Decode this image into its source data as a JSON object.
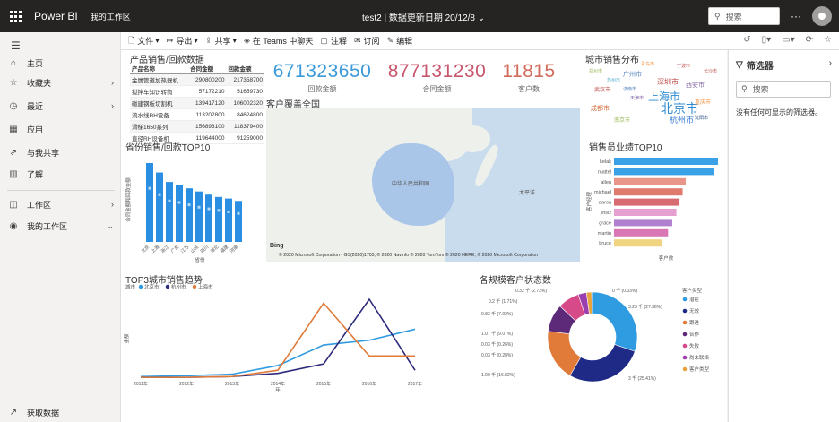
{
  "topbar": {
    "app_name": "Power BI",
    "workspace": "我的工作区",
    "report_title": "test2 | 数据更新日期 20/12/8",
    "search_placeholder": "搜索",
    "more": "···"
  },
  "toolbar": {
    "items": [
      {
        "label": "文件",
        "icon": "file-icon",
        "caret": "▾"
      },
      {
        "label": "导出",
        "icon": "export-icon",
        "caret": "▾"
      },
      {
        "label": "共享",
        "icon": "share-icon",
        "caret": "▾"
      },
      {
        "label": "在 Teams 中聊天",
        "icon": "teams-icon",
        "caret": ""
      },
      {
        "label": "注释",
        "icon": "comment-icon",
        "caret": ""
      },
      {
        "label": "订阅",
        "icon": "mail-icon",
        "caret": ""
      },
      {
        "label": "编辑",
        "icon": "edit-icon",
        "caret": ""
      }
    ]
  },
  "sidebar": {
    "items": [
      {
        "label": "主页",
        "icon": "home-icon"
      },
      {
        "label": "收藏夹",
        "icon": "star-icon",
        "chevron": "›"
      },
      {
        "label": "最近",
        "icon": "clock-icon",
        "chevron": "›"
      },
      {
        "label": "应用",
        "icon": "apps-icon"
      },
      {
        "label": "与我共享",
        "icon": "shared-icon"
      },
      {
        "label": "了解",
        "icon": "book-icon"
      },
      {
        "label": "工作区",
        "icon": "workspace-icon",
        "chevron": "›"
      },
      {
        "label": "我的工作区",
        "icon": "my-workspace-icon",
        "chevron": "⌄"
      }
    ],
    "get_data": "获取数据"
  },
  "filters": {
    "title": "筛选器",
    "search_placeholder": "搜索",
    "empty_text": "没有任何可显示的筛选器。"
  },
  "visuals": {
    "table": {
      "title": "产品销售/回款数据",
      "headers": [
        "产品名称",
        "合同金额",
        "回款金额"
      ],
      "rows": [
        [
          "金属管道加热器机",
          "290800200",
          "217358700"
        ],
        [
          "搅拌车知识转筒",
          "57172210",
          "51659730"
        ],
        [
          "磁建钢板切割机",
          "139417120",
          "106002320"
        ],
        [
          "流水线RH设备",
          "113202800",
          "84624800"
        ],
        [
          "滑梯1650系列",
          "156893100",
          "118379400"
        ],
        [
          "直径RH设备机",
          "119644000",
          "91259000"
        ]
      ]
    },
    "kpis": [
      {
        "value": "671323650",
        "label": "回款金额",
        "color": "#3a9ad9"
      },
      {
        "value": "877131230",
        "label": "合同金额",
        "color": "#c8566e"
      },
      {
        "value": "11815",
        "label": "客户数",
        "color": "#d16b5b"
      }
    ],
    "map": {
      "title": "客户覆盖全国",
      "label_china": "中华人民共和国",
      "label_ocean": "太平洋",
      "bing": "Bing",
      "attribution": "© 2020 Microsoft Corporation - GS(2020)1703, © 2020 Navinfo © 2020 TomTom © 2020 HERE, © 2020 Microsoft Corporation"
    },
    "wordcloud": {
      "title": "城市销售分布",
      "words": [
        {
          "text": "上海市",
          "size": 12,
          "color": "#2e8bd1"
        },
        {
          "text": "北京市",
          "size": 14,
          "color": "#2e8bd1"
        },
        {
          "text": "杭州市",
          "size": 9,
          "color": "#3a7bd5"
        },
        {
          "text": "深圳市",
          "size": 8,
          "color": "#c0504d"
        },
        {
          "text": "西安市",
          "size": 7,
          "color": "#8064a2"
        },
        {
          "text": "成都市",
          "size": 7,
          "color": "#d4693b"
        },
        {
          "text": "广州市",
          "size": 7,
          "color": "#4f81bd"
        },
        {
          "text": "南京市",
          "size": 6,
          "color": "#9bbb59"
        },
        {
          "text": "武汉市",
          "size": 6,
          "color": "#c0504d"
        },
        {
          "text": "重庆市",
          "size": 6,
          "color": "#f79646"
        },
        {
          "text": "天津市",
          "size": 5,
          "color": "#8064a2"
        },
        {
          "text": "苏州市",
          "size": 5,
          "color": "#4bacc6"
        },
        {
          "text": "长沙市",
          "size": 5,
          "color": "#c0504d"
        },
        {
          "text": "郑州市",
          "size": 5,
          "color": "#9bbb59"
        },
        {
          "text": "沈阳市",
          "size": 5,
          "color": "#1f497d"
        },
        {
          "text": "青岛市",
          "size": 5,
          "color": "#f79646"
        },
        {
          "text": "宁波市",
          "size": 5,
          "color": "#c0504d"
        },
        {
          "text": "济南市",
          "size": 5,
          "color": "#4f81bd"
        }
      ]
    }
  },
  "chart_data": [
    {
      "type": "bar",
      "title": "省份销售/回款TOP10",
      "xlabel": "省份",
      "ylabel": "合同金额和回款金额",
      "categories": [
        "北京",
        "上海",
        "浙江",
        "广东",
        "江苏",
        "山东",
        "四川",
        "湖北",
        "福建",
        "河南"
      ],
      "values": [
        1.0,
        0.88,
        0.76,
        0.72,
        0.68,
        0.64,
        0.6,
        0.57,
        0.55,
        0.52
      ],
      "marker_values": [
        0.68,
        0.6,
        0.52,
        0.5,
        0.47,
        0.44,
        0.42,
        0.4,
        0.38,
        0.36
      ],
      "color": "#2a8fe3"
    },
    {
      "type": "bar",
      "orientation": "horizontal",
      "title": "销售员业绩TOP10",
      "xlabel": "客户数",
      "ylabel": "客户经理",
      "categories": [
        "kelak",
        "mattel",
        "allen",
        "michael",
        "aaron",
        "jihsiz",
        "grace",
        "martin",
        "bruce"
      ],
      "values": [
        100,
        96,
        69,
        66,
        63,
        60,
        56,
        52,
        46
      ],
      "colors": [
        "#3aa1e6",
        "#3aa1e6",
        "#e8968a",
        "#e07a6d",
        "#d86a72",
        "#e5a0d0",
        "#b07fd0",
        "#d977b5",
        "#f0d482"
      ]
    },
    {
      "type": "line",
      "title": "TOP3城市销售趋势",
      "legend_title": "城市",
      "xlabel": "年",
      "ylabel": "金额",
      "x": [
        "2011年",
        "2012年",
        "2013年",
        "2014年",
        "2015年",
        "2016年",
        "2017年"
      ],
      "series": [
        {
          "name": "北京市",
          "color": "#2f9be0",
          "values": [
            0.02,
            0.03,
            0.05,
            0.16,
            0.42,
            0.48,
            0.62
          ]
        },
        {
          "name": "杭州市",
          "color": "#2c2a7a",
          "values": [
            0.01,
            0.01,
            0.02,
            0.06,
            0.18,
            1.0,
            0.1
          ]
        },
        {
          "name": "上海市",
          "color": "#e07b39",
          "values": [
            0.01,
            0.01,
            0.02,
            0.1,
            0.95,
            0.28,
            0.28
          ]
        }
      ]
    },
    {
      "type": "pie",
      "subtype": "donut",
      "title": "各规模客户状态数",
      "legend_title": "客户类型",
      "slices": [
        {
          "name": "潜在",
          "value": 3230,
          "label": "3.23 千 (27.36%)",
          "color": "#2f9be0"
        },
        {
          "name": "无效",
          "value": 3000,
          "label": "3 千 (25.41%)",
          "color": "#1f2a87"
        },
        {
          "name": "跟进",
          "value": 1990,
          "label": "1.99 千 (16.82%)",
          "color": "#e07b39"
        },
        {
          "name": "合作",
          "value": 1070,
          "label": "1.07 千 (9.07%)",
          "color": "#5d2a7a"
        },
        {
          "name": "失败",
          "value": 830,
          "label": "0.83 千 (7.02%)",
          "color": "#d64a8a"
        },
        {
          "name": "尚未联络",
          "value": 320,
          "label": "0.32 千 (2.73%)",
          "color": "#9b3fae"
        },
        {
          "name": "客户类型",
          "value": 200,
          "label": "0.2 千 (1.71%)",
          "color": "#e8a33d"
        },
        {
          "name": "其他",
          "value": 30,
          "label": "0 千 (0.03%)",
          "color": "#7b52c8"
        }
      ],
      "extra_labels": [
        "0.03 千 (0.26%)",
        "0.03 千 (0.28%)"
      ]
    }
  ]
}
